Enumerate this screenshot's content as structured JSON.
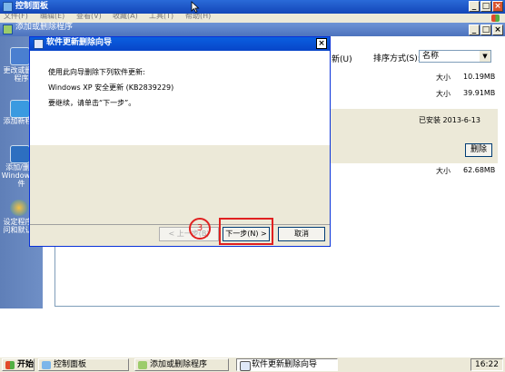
{
  "control_panel": {
    "title": "控制面板",
    "menu": [
      "文件(F)",
      "编辑(E)",
      "查看(V)",
      "收藏(A)",
      "工具(T)",
      "帮助(H)"
    ],
    "controls": [
      "_",
      "□",
      "×"
    ]
  },
  "add_remove": {
    "title": "添加或删除程序",
    "controls": [
      "_",
      "□",
      "×"
    ],
    "sidebar": [
      {
        "label": "更改或删除程序",
        "icon": "change-remove-programs-icon"
      },
      {
        "label": "添加新程序",
        "icon": "add-new-programs-icon"
      },
      {
        "label": "添加/删除Windows组件",
        "icon": "windows-components-icon"
      },
      {
        "label": "设定程序访问和默认值",
        "icon": "set-program-access-icon"
      }
    ],
    "partial_header": "新(U)",
    "sort_label": "排序方式(S):",
    "sort_value": "名称",
    "sizes": [
      {
        "label": "大小",
        "value": "10.19MB"
      },
      {
        "label": "大小",
        "value": "39.91MB"
      },
      {
        "label": "大小",
        "value": "62.68MB"
      }
    ],
    "installed_label": "已安装",
    "installed_date": "2013-6-13",
    "remove_button": "删除"
  },
  "wizard": {
    "title": "软件更新删除向导",
    "close": "×",
    "line1": "使用此向导删除下列软件更新:",
    "line2": "Windows XP 安全更新 (KB2839229)",
    "line3": "要继续，请单击“下一步”。",
    "back_button": "< 上一步(B)",
    "next_button": "下一步(N) >",
    "cancel_button": "取消",
    "annotation_number": "3"
  },
  "taskbar": {
    "start": "开始",
    "items": [
      "控制面板",
      "添加或删除程序",
      "软件更新删除向导"
    ],
    "clock": "16:22"
  }
}
